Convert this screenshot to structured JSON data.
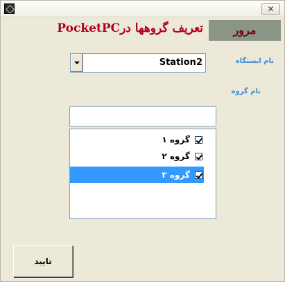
{
  "window": {
    "close_symbol": "✕",
    "app_icon": "app-icon"
  },
  "header": {
    "title": "تعریف گروهها درPocketPC",
    "nav_button_label": "مرور"
  },
  "form": {
    "station_label": "نام ایستگاه",
    "station_value": "Station2",
    "group_label": "نام گروه",
    "group_input_value": ""
  },
  "groups": [
    {
      "label": "گروه ۱",
      "checked": true,
      "selected": false
    },
    {
      "label": "گروه ۲",
      "checked": true,
      "selected": false
    },
    {
      "label": "گروه ۳",
      "checked": true,
      "selected": true
    }
  ],
  "actions": {
    "ok_label": "تایید"
  },
  "colors": {
    "title_color": "#b0001f",
    "nav_bg": "#8a9585",
    "label_color": "#3b8bd6",
    "selection_bg": "#3399ff"
  }
}
